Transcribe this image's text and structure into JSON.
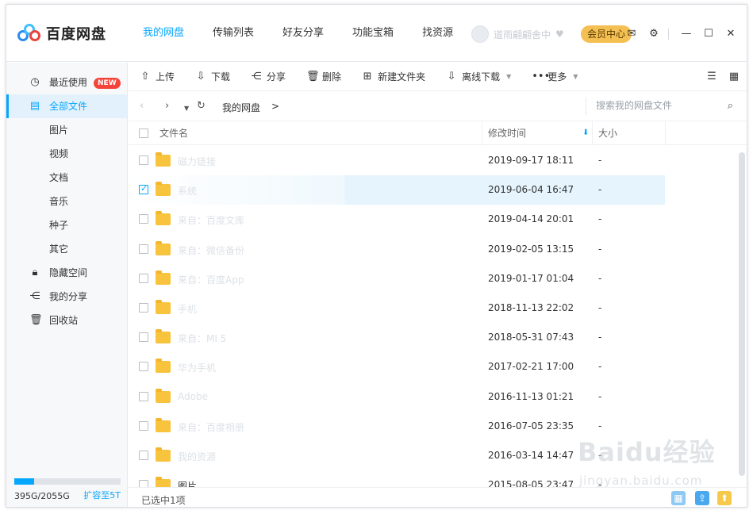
{
  "app": {
    "name": "百度网盘"
  },
  "nav": {
    "tabs": [
      {
        "label": "我的网盘",
        "active": true
      },
      {
        "label": "传输列表"
      },
      {
        "label": "好友分享"
      },
      {
        "label": "功能宝箱"
      },
      {
        "label": "找资源"
      }
    ]
  },
  "user": {
    "name": "道雨翩翩舍中",
    "vip_button": "会员中心"
  },
  "titlebar_icons": [
    "mail-icon",
    "settings-icon",
    "minimize-icon",
    "maximize-icon",
    "close-icon"
  ],
  "sidebar": {
    "items": [
      {
        "label": "最近使用",
        "icon": "clock-icon",
        "badge": "NEW"
      },
      {
        "label": "全部文件",
        "icon": "document-icon",
        "active": true
      },
      {
        "label": "图片"
      },
      {
        "label": "视频"
      },
      {
        "label": "文档"
      },
      {
        "label": "音乐"
      },
      {
        "label": "种子"
      },
      {
        "label": "其它"
      },
      {
        "label": "隐藏空间",
        "icon": "lock-icon"
      },
      {
        "label": "我的分享",
        "icon": "share-icon"
      },
      {
        "label": "回收站",
        "icon": "trash-icon"
      }
    ],
    "quota": {
      "text": "395G/2055G",
      "used_fraction": 0.19,
      "expand_label": "扩容至5T"
    }
  },
  "toolbar": {
    "upload": "上传",
    "download": "下载",
    "share": "分享",
    "delete": "删除",
    "new_folder": "新建文件夹",
    "offline_download": "离线下载",
    "more": "更多"
  },
  "pathbar": {
    "breadcrumb": "我的网盘",
    "separator": ">",
    "search_placeholder": "搜索我的网盘文件"
  },
  "table": {
    "columns": {
      "name": "文件名",
      "modified": "修改时间",
      "size": "大小"
    },
    "rows": [
      {
        "name": "磁力链接",
        "modified": "2019-09-17 18:11",
        "size": "-"
      },
      {
        "name": "系统",
        "modified": "2019-06-04 16:47",
        "size": "-",
        "selected": true
      },
      {
        "name": "来自：百度文库",
        "modified": "2019-04-14 20:01",
        "size": "-"
      },
      {
        "name": "来自：微信备份",
        "modified": "2019-02-05 13:15",
        "size": "-"
      },
      {
        "name": "来自：百度App",
        "modified": "2019-01-17 01:04",
        "size": "-"
      },
      {
        "name": "手机",
        "modified": "2018-11-13 22:02",
        "size": "-"
      },
      {
        "name": "来自：MI 5",
        "modified": "2018-05-31 07:43",
        "size": "-"
      },
      {
        "name": "华为手机",
        "modified": "2017-02-21 17:00",
        "size": "-"
      },
      {
        "name": "Adobe",
        "modified": "2016-11-13 01:21",
        "size": "-"
      },
      {
        "name": "来自：百度相册",
        "modified": "2016-07-05 23:35",
        "size": "-"
      },
      {
        "name": "我的资源",
        "modified": "2016-03-14 14:47",
        "size": "-"
      },
      {
        "name": "图片",
        "modified": "2015-08-05 23:47",
        "size": "-",
        "visible_name": true
      }
    ]
  },
  "status": {
    "text": "已选中1项"
  },
  "watermark": {
    "main": "Baidu经验",
    "sub": "jingyan.baidu.com"
  },
  "colors": {
    "accent": "#06a7ff",
    "vip": "#f5c053",
    "folder": "#f8c43e"
  }
}
